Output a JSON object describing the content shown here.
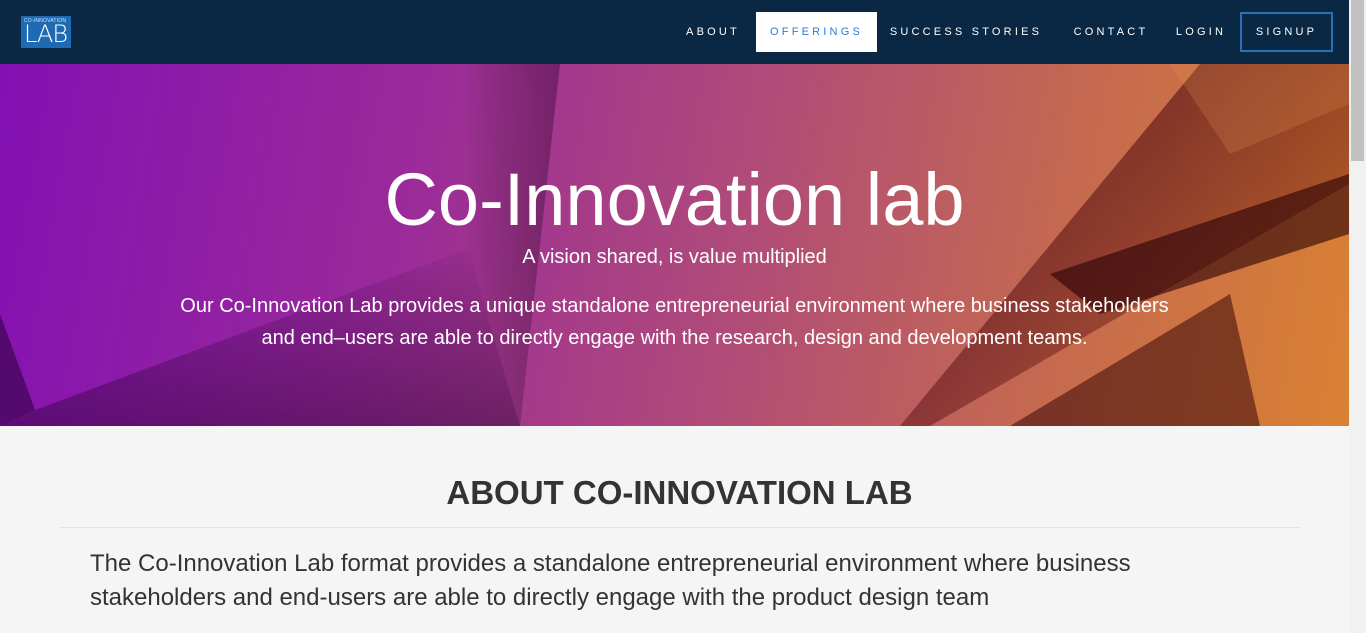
{
  "navbar": {
    "logo_small": "CO-INNOVATION",
    "logo_text": "LAB",
    "items": [
      {
        "label": "ABOUT"
      },
      {
        "label": "OFFERINGS"
      },
      {
        "label": "SUCCESS STORIES"
      },
      {
        "label": "CONTACT"
      },
      {
        "label": "LOGIN"
      },
      {
        "label": "SIGNUP"
      }
    ],
    "active_item": "OFFERINGS",
    "colors": {
      "background": "#0a2744",
      "active_text": "#2a7bd6",
      "signup_border": "#2d6eb8"
    }
  },
  "hero": {
    "title": "Co-Innovation lab",
    "tagline": "A vision shared, is value multiplied",
    "description": "Our Co-Innovation Lab provides a unique standalone entrepreneurial environment where business stakeholders and end–users are able to directly engage with the research, design and development teams.",
    "colors": {
      "gradient_start": "#8310b3",
      "gradient_end": "#d98133"
    }
  },
  "about": {
    "heading": "ABOUT CO-INNOVATION LAB",
    "text": "The Co-Innovation Lab format provides a standalone entrepreneurial environment where business stakeholders and end-users are able to directly engage with the product design team"
  }
}
